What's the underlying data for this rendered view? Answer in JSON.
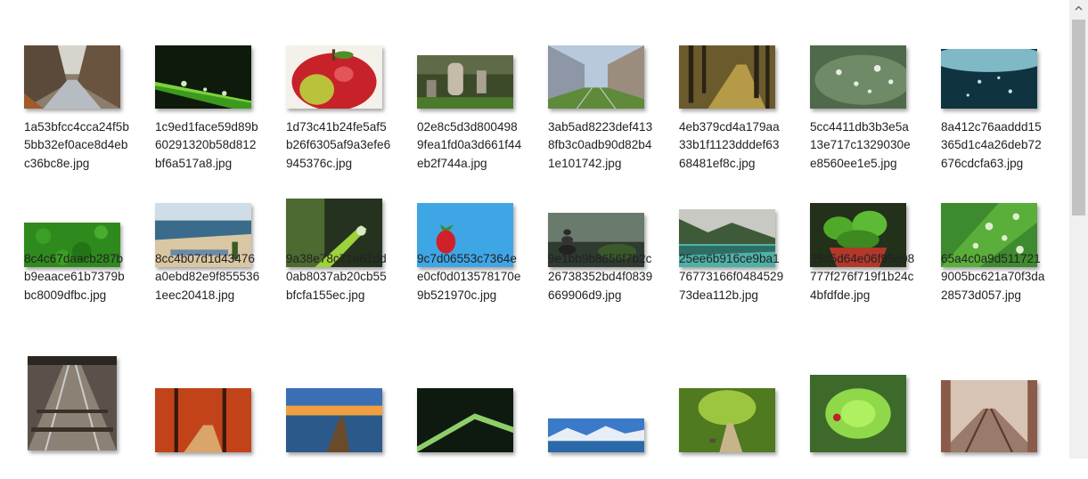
{
  "files": [
    {
      "name": "1a53bfcc4cca24f5b5bb32ef0ace8d4ebc36bc8e.jpg",
      "scene": "road"
    },
    {
      "name": "1c9ed1face59d89b60291320b58d812bf6a517a8.jpg",
      "scene": "leafdrops"
    },
    {
      "name": "1d73c41b24fe5af5b26f6305af9a3efe6945376c.jpg",
      "scene": "apple"
    },
    {
      "name": "02e8c5d3d8004989fea1fd0a3d661f44eb2f744a.jpg",
      "scene": "graveyard"
    },
    {
      "name": "3ab5ad8223def4138fb3c0adb90d82b41e101742.jpg",
      "scene": "tram"
    },
    {
      "name": "4eb379cd4a179aa33b1f1123dddef6368481ef8c.jpg",
      "scene": "forestpath"
    },
    {
      "name": "5cc4411db3b3e5a13e717c1329030ee8560ee1e5.jpg",
      "scene": "dewleaf"
    },
    {
      "name": "8a412c76aaddd15365d1c4a26deb72676cdcfa63.jpg",
      "scene": "teal"
    },
    {
      "name": "8c4c67daacb287bb9eaace61b7379bbc8009dfbc.jpg",
      "scene": "grass"
    },
    {
      "name": "8cc4b07d1d43476a0ebd82e9f8555361eec20418.jpg",
      "scene": "beach"
    },
    {
      "name": "9a38e78c71e61dd0ab8037ab20cb55bfcfa155ec.jpg",
      "scene": "blade"
    },
    {
      "name": "9c7d06553c7364ee0cf0d013578170e9b521970c.jpg",
      "scene": "strawberry"
    },
    {
      "name": "9e1bb9b8656f7b2c26738352bd4f0839669906d9.jpg",
      "scene": "stones"
    },
    {
      "name": "25ee6b916ce9ba176773166f048452973dea112b.jpg",
      "scene": "lake"
    },
    {
      "name": "35d5d64e06f95e08777f276f719f1b24c4bfdfde.jpg",
      "scene": "basil"
    },
    {
      "name": "65a4c0a9d5117219005bc621a70f3da28573d057.jpg",
      "scene": "rainleaf"
    },
    {
      "name": "",
      "scene": "rails"
    },
    {
      "name": "",
      "scene": "autumn"
    },
    {
      "name": "",
      "scene": "pier"
    },
    {
      "name": "",
      "scene": "grassdark"
    },
    {
      "name": "",
      "scene": "mountains"
    },
    {
      "name": "",
      "scene": "park"
    },
    {
      "name": "",
      "scene": "ladybug"
    },
    {
      "name": "",
      "scene": "snowrails"
    }
  ],
  "icons": {
    "scroll_up": "chevron-up-icon"
  }
}
